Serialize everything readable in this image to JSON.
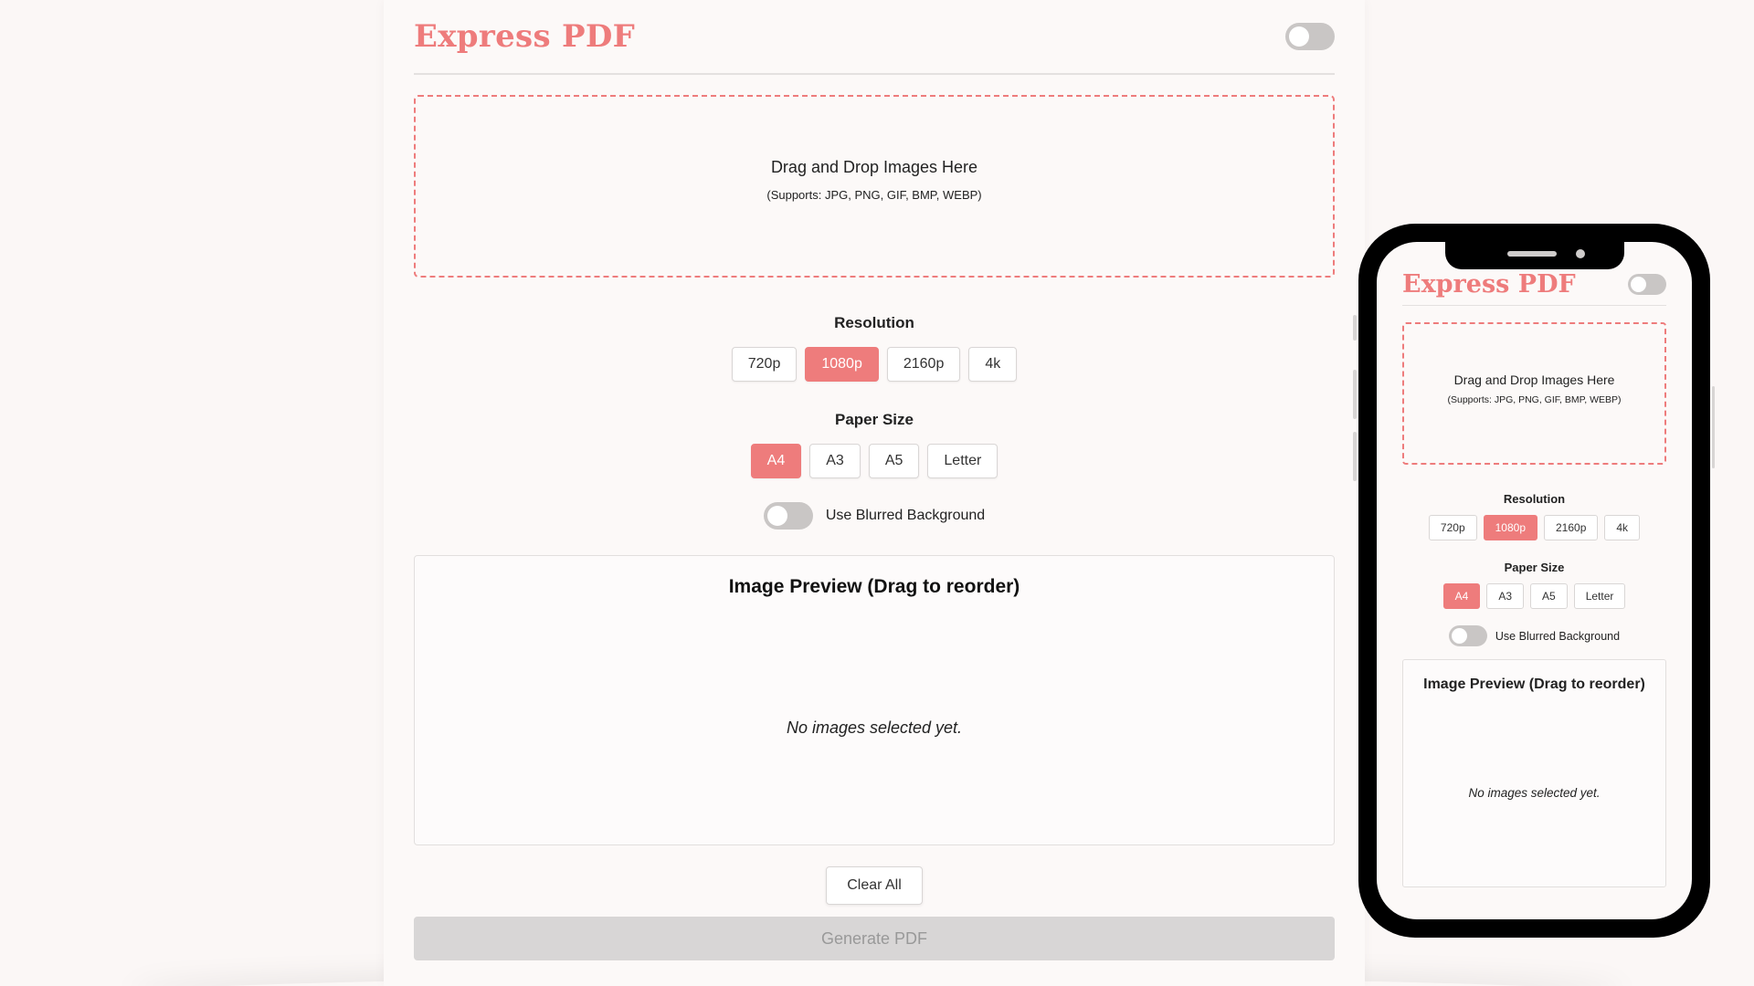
{
  "app": {
    "brand": "Express PDF"
  },
  "dropzone": {
    "title": "Drag and Drop Images Here",
    "subtitle": "(Supports: JPG, PNG, GIF, BMP, WEBP)"
  },
  "resolution": {
    "label": "Resolution",
    "options": [
      "720p",
      "1080p",
      "2160p",
      "4k"
    ],
    "selected": "1080p"
  },
  "paper_size": {
    "label": "Paper Size",
    "options": [
      "A4",
      "A3",
      "A5",
      "Letter"
    ],
    "selected": "A4"
  },
  "blur": {
    "label": "Use Blurred Background",
    "enabled": false
  },
  "theme_toggle": {
    "enabled": false
  },
  "preview": {
    "title": "Image Preview (Drag to reorder)",
    "empty_text": "No images selected yet."
  },
  "actions": {
    "clear_label": "Clear All",
    "generate_label": "Generate PDF"
  },
  "colors": {
    "accent": "#ee7c7c",
    "disabled": "#d8d6d6"
  }
}
